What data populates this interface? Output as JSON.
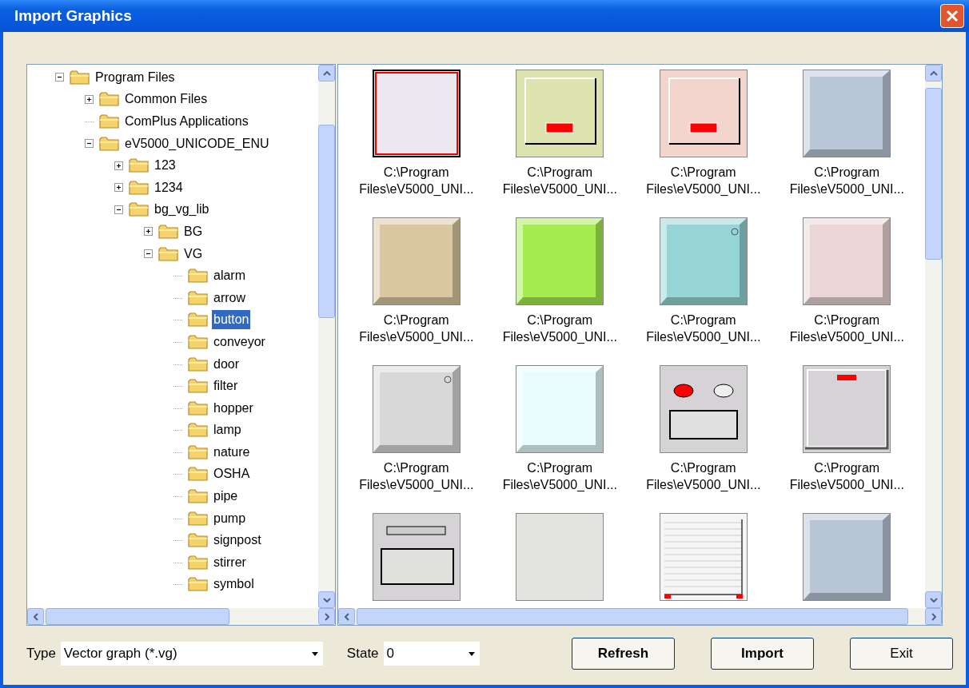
{
  "window": {
    "title": "Import Graphics"
  },
  "tree": [
    {
      "label": "Program Files",
      "expandable": true,
      "expanded": true,
      "selected": false,
      "children": [
        {
          "label": "Common Files",
          "expandable": true,
          "expanded": false,
          "selected": false
        },
        {
          "label": "ComPlus Applications",
          "expandable": false,
          "selected": false
        },
        {
          "label": "eV5000_UNICODE_ENU",
          "expandable": true,
          "expanded": true,
          "selected": false,
          "children": [
            {
              "label": "123",
              "expandable": true,
              "expanded": false,
              "selected": false
            },
            {
              "label": "1234",
              "expandable": true,
              "expanded": false,
              "selected": false
            },
            {
              "label": "bg_vg_lib",
              "expandable": true,
              "expanded": true,
              "selected": false,
              "children": [
                {
                  "label": "BG",
                  "expandable": true,
                  "expanded": false,
                  "selected": false
                },
                {
                  "label": "VG",
                  "expandable": true,
                  "expanded": true,
                  "selected": false,
                  "children": [
                    {
                      "label": "alarm",
                      "expandable": false,
                      "selected": false
                    },
                    {
                      "label": "arrow",
                      "expandable": false,
                      "selected": false
                    },
                    {
                      "label": "button",
                      "expandable": false,
                      "selected": true
                    },
                    {
                      "label": "conveyor",
                      "expandable": false,
                      "selected": false
                    },
                    {
                      "label": "door",
                      "expandable": false,
                      "selected": false
                    },
                    {
                      "label": "filter",
                      "expandable": false,
                      "selected": false
                    },
                    {
                      "label": "hopper",
                      "expandable": false,
                      "selected": false
                    },
                    {
                      "label": "lamp",
                      "expandable": false,
                      "selected": false
                    },
                    {
                      "label": "nature",
                      "expandable": false,
                      "selected": false
                    },
                    {
                      "label": "OSHA",
                      "expandable": false,
                      "selected": false
                    },
                    {
                      "label": "pipe",
                      "expandable": false,
                      "selected": false
                    },
                    {
                      "label": "pump",
                      "expandable": false,
                      "selected": false
                    },
                    {
                      "label": "signpost",
                      "expandable": false,
                      "selected": false
                    },
                    {
                      "label": "stirrer",
                      "expandable": false,
                      "selected": false
                    },
                    {
                      "label": "symbol",
                      "expandable": false,
                      "selected": false
                    }
                  ]
                }
              ]
            }
          ]
        }
      ]
    }
  ],
  "graphics": [
    {
      "kind": "framed",
      "color": "#ebe8ef",
      "caption": [
        "C:\\Program",
        "Files\\eV5000_UNI..."
      ]
    },
    {
      "kind": "panel",
      "color": "#dde3ae",
      "caption": [
        "C:\\Program",
        "Files\\eV5000_UNI..."
      ]
    },
    {
      "kind": "panel",
      "color": "#f3d5cd",
      "caption": [
        "C:\\Program",
        "Files\\eV5000_UNI..."
      ]
    },
    {
      "kind": "bevel",
      "color": "#bac7d8",
      "caption": [
        "C:\\Program",
        "Files\\eV5000_UNI..."
      ]
    },
    {
      "kind": "bevel",
      "color": "#dac7a0",
      "caption": [
        "C:\\Program",
        "Files\\eV5000_UNI..."
      ]
    },
    {
      "kind": "bevel",
      "color": "#a4ec50",
      "caption": [
        "C:\\Program",
        "Files\\eV5000_UNI..."
      ]
    },
    {
      "kind": "bevel-dot",
      "color": "#95d5d5",
      "caption": [
        "C:\\Program",
        "Files\\eV5000_UNI..."
      ]
    },
    {
      "kind": "bevel",
      "color": "#ebd5d5",
      "caption": [
        "C:\\Program",
        "Files\\eV5000_UNI..."
      ]
    },
    {
      "kind": "bevel-dot",
      "color": "#d8d8d8",
      "caption": [
        "C:\\Program",
        "Files\\eV5000_UNI..."
      ]
    },
    {
      "kind": "bevel",
      "color": "#e8fcfc",
      "caption": [
        "C:\\Program",
        "Files\\eV5000_UNI..."
      ]
    },
    {
      "kind": "switch",
      "color": "#d6d3d6",
      "caption": [
        "C:\\Program",
        "Files\\eV5000_UNI..."
      ]
    },
    {
      "kind": "led-top",
      "color": "#d6d3d6",
      "caption": [
        "C:\\Program",
        "Files\\eV5000_UNI..."
      ]
    },
    {
      "kind": "window",
      "color": "#d6d3d6"
    },
    {
      "kind": "flat",
      "color": "#e3e3e0"
    },
    {
      "kind": "shutter",
      "color": "#f5f5f5"
    },
    {
      "kind": "bevel",
      "color": "#b8c5d6"
    }
  ],
  "type_field": {
    "label": "Type",
    "value": "Vector graph (*.vg)"
  },
  "state_field": {
    "label": "State",
    "value": "0"
  },
  "buttons": [
    {
      "label": "Refresh",
      "bold": true
    },
    {
      "label": "Import",
      "bold": true
    },
    {
      "label": "Exit",
      "bold": false
    }
  ]
}
